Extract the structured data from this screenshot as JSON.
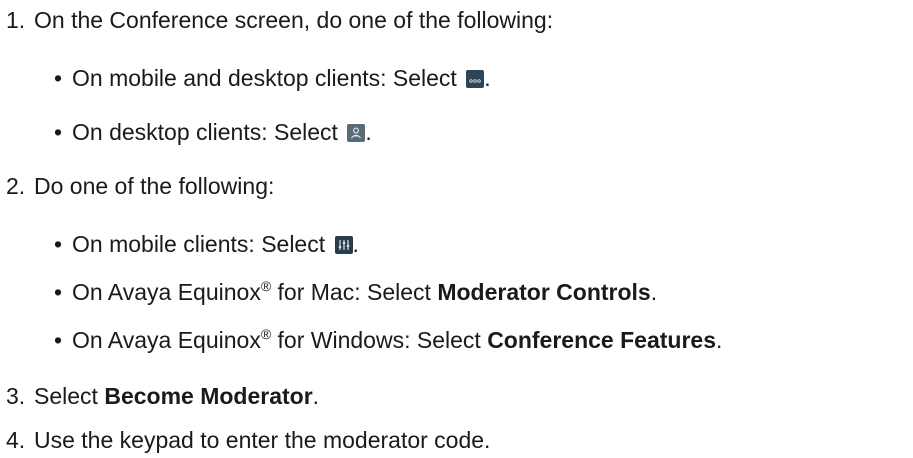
{
  "steps": [
    {
      "number": "1.",
      "text": "On the Conference screen, do one of the following:",
      "bullets": [
        {
          "marker": "•",
          "text": "On mobile and desktop clients: Select ",
          "icon": "more-options-icon",
          "after": "."
        },
        {
          "marker": "•",
          "text": "On desktop clients: Select ",
          "icon": "participants-icon",
          "after": "."
        }
      ]
    },
    {
      "number": "2.",
      "text": "Do one of the following:",
      "bullets": [
        {
          "marker": "•",
          "text": "On mobile clients: Select ",
          "icon": "moderator-controls-icon",
          "after": "."
        },
        {
          "marker": "•",
          "text_before": "On Avaya Equinox",
          "sup": "®",
          "text_mid": " for Mac: Select ",
          "bold": "Moderator Controls",
          "after": "."
        },
        {
          "marker": "•",
          "text_before": "On Avaya Equinox",
          "sup": "®",
          "text_mid": " for Windows: Select ",
          "bold": "Conference Features",
          "after": "."
        }
      ]
    },
    {
      "number": "3.",
      "text": "Select ",
      "bold": "Become Moderator",
      "after": "."
    },
    {
      "number": "4.",
      "text": "Use the keypad to enter the moderator code."
    }
  ]
}
